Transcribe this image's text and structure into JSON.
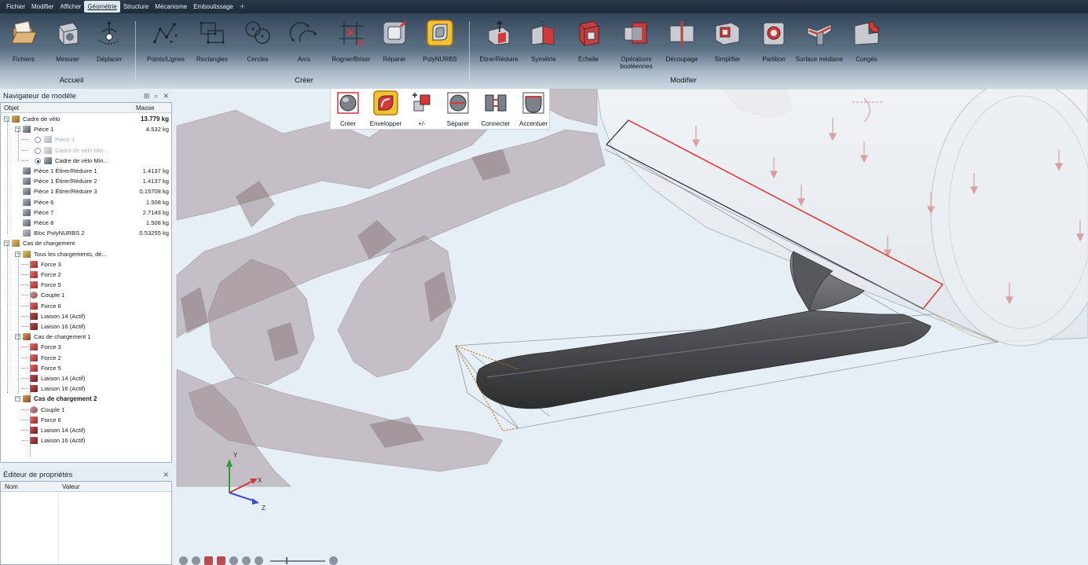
{
  "menu": {
    "items": [
      "Fichier",
      "Modifier",
      "Afficher",
      "Géométrie",
      "Structure",
      "Mécanisme",
      "Emboutissage"
    ],
    "active": "Géométrie",
    "add_tab": "+"
  },
  "ribbon": {
    "groups": [
      {
        "label": "Accueil",
        "tools": [
          "Fichiers",
          "Mesurer",
          "Déplacer"
        ]
      },
      {
        "label": "Créer",
        "tools": [
          "Points/Lignes",
          "Rectangles",
          "Cercles",
          "Arcs",
          "Rogner/Briser",
          "Réparer",
          "PolyNURBS"
        ]
      },
      {
        "label": "Modifier",
        "tools": [
          "Étirer/Réduire",
          "Symétrie",
          "Échelle",
          "Opérations booléennes",
          "Découpage",
          "Simplifier",
          "Partition",
          "Surface médiane",
          "Congés"
        ]
      }
    ],
    "active_tool": "PolyNURBS",
    "accent": "#e2a51e",
    "icon_red": "#d23a3a"
  },
  "mini_toolbar": {
    "tools": [
      "Créer",
      "Envelopper",
      "+/-",
      "Séparer",
      "Connecter",
      "Accentuer"
    ],
    "active": "Envelopper"
  },
  "navigator": {
    "title": "Navigateur de modèle",
    "columns": {
      "object": "Objet",
      "mass": "Masse"
    },
    "rows": [
      {
        "label": "Cadre de vélo",
        "mass": "13.779 kg",
        "bold_mass": true,
        "icon": "assembly-icon",
        "toggle": "−",
        "level": 0
      },
      {
        "label": "Pièce 1",
        "mass": "4.532 kg",
        "icon": "part-icon",
        "toggle": "−",
        "level": 1
      },
      {
        "label": "Pièce 1",
        "mass": "",
        "icon": "part-icon",
        "radio": "off",
        "dim": true,
        "level": 2
      },
      {
        "label": "Cadre de vélo Min...",
        "mass": "",
        "icon": "part-icon",
        "radio": "off",
        "dim": true,
        "level": 2
      },
      {
        "label": "Cadre de vélo Min...",
        "mass": "",
        "icon": "part-icon",
        "radio": "on",
        "level": 2
      },
      {
        "label": "Pièce 1 Étirer/Réduire 1",
        "mass": "1.4137 kg",
        "icon": "part-icon",
        "level": 1
      },
      {
        "label": "Pièce 1 Étirer/Réduire 2",
        "mass": "1.4137 kg",
        "icon": "part-icon",
        "level": 1
      },
      {
        "label": "Pièce 1 Étirer/Réduire 3",
        "mass": "0.15708 kg",
        "icon": "part-icon",
        "level": 1
      },
      {
        "label": "Pièce 6",
        "mass": "1.508 kg",
        "icon": "part-icon",
        "level": 1
      },
      {
        "label": "Pièce 7",
        "mass": "2.7143 kg",
        "icon": "part-icon",
        "level": 1
      },
      {
        "label": "Pièce 8",
        "mass": "1.508 kg",
        "icon": "part-icon",
        "level": 1
      },
      {
        "label": "Bloc PolyNURBS 2",
        "mass": "0.53255 kg",
        "icon": "polynurbs-icon",
        "level": 1
      },
      {
        "label": "Cas de chargement",
        "mass": "",
        "icon": "folder-icon",
        "toggle": "−",
        "level": 0
      },
      {
        "label": "Tous les chargements, dé...",
        "mass": "",
        "icon": "folder-icon",
        "toggle": "−",
        "level": 1
      },
      {
        "label": "Force 3",
        "mass": "",
        "icon": "force-icon",
        "level": 2
      },
      {
        "label": "Force 2",
        "mass": "",
        "icon": "force-icon",
        "level": 2
      },
      {
        "label": "Force 5",
        "mass": "",
        "icon": "force-icon",
        "level": 2
      },
      {
        "label": "Couple 1",
        "mass": "",
        "icon": "torque-icon",
        "level": 2
      },
      {
        "label": "Force 6",
        "mass": "",
        "icon": "force-icon",
        "level": 2
      },
      {
        "label": "Liaison 14 (Actif)",
        "mass": "",
        "icon": "constraint-icon",
        "level": 2
      },
      {
        "label": "Liaison 16 (Actif)",
        "mass": "",
        "icon": "constraint-icon",
        "level": 2
      },
      {
        "label": "Cas de chargement 1",
        "mass": "",
        "icon": "loadcase-icon",
        "toggle": "−",
        "level": 1
      },
      {
        "label": "Force 3",
        "mass": "",
        "icon": "force-icon",
        "level": 2
      },
      {
        "label": "Force 2",
        "mass": "",
        "icon": "force-icon",
        "level": 2
      },
      {
        "label": "Force 5",
        "mass": "",
        "icon": "force-icon",
        "level": 2
      },
      {
        "label": "Liaison 14 (Actif)",
        "mass": "",
        "icon": "constraint-icon",
        "level": 2
      },
      {
        "label": "Liaison 16 (Actif)",
        "mass": "",
        "icon": "constraint-icon",
        "level": 2
      },
      {
        "label": "Cas de chargement 2",
        "mass": "",
        "icon": "loadcase-icon",
        "toggle": "−",
        "bold": true,
        "level": 1
      },
      {
        "label": "Couple 1",
        "mass": "",
        "icon": "torque-icon",
        "level": 2
      },
      {
        "label": "Force 6",
        "mass": "",
        "icon": "force-icon",
        "level": 2
      },
      {
        "label": "Liaison 14 (Actif)",
        "mass": "",
        "icon": "constraint-icon",
        "level": 2
      },
      {
        "label": "Liaison 16 (Actif)",
        "mass": "",
        "icon": "constraint-icon",
        "level": 2
      }
    ]
  },
  "properties": {
    "title": "Éditeur de propriétés",
    "columns": {
      "name": "Nom",
      "value": "Valeur"
    }
  },
  "triad": {
    "x": "X",
    "y": "Y",
    "z": "Z"
  },
  "colors": {
    "viewport_bg": "#e6eef6",
    "ribbon_dark": "#34475a",
    "selection_red": "#e03a3a",
    "mesh_fill": "#8d7478"
  }
}
